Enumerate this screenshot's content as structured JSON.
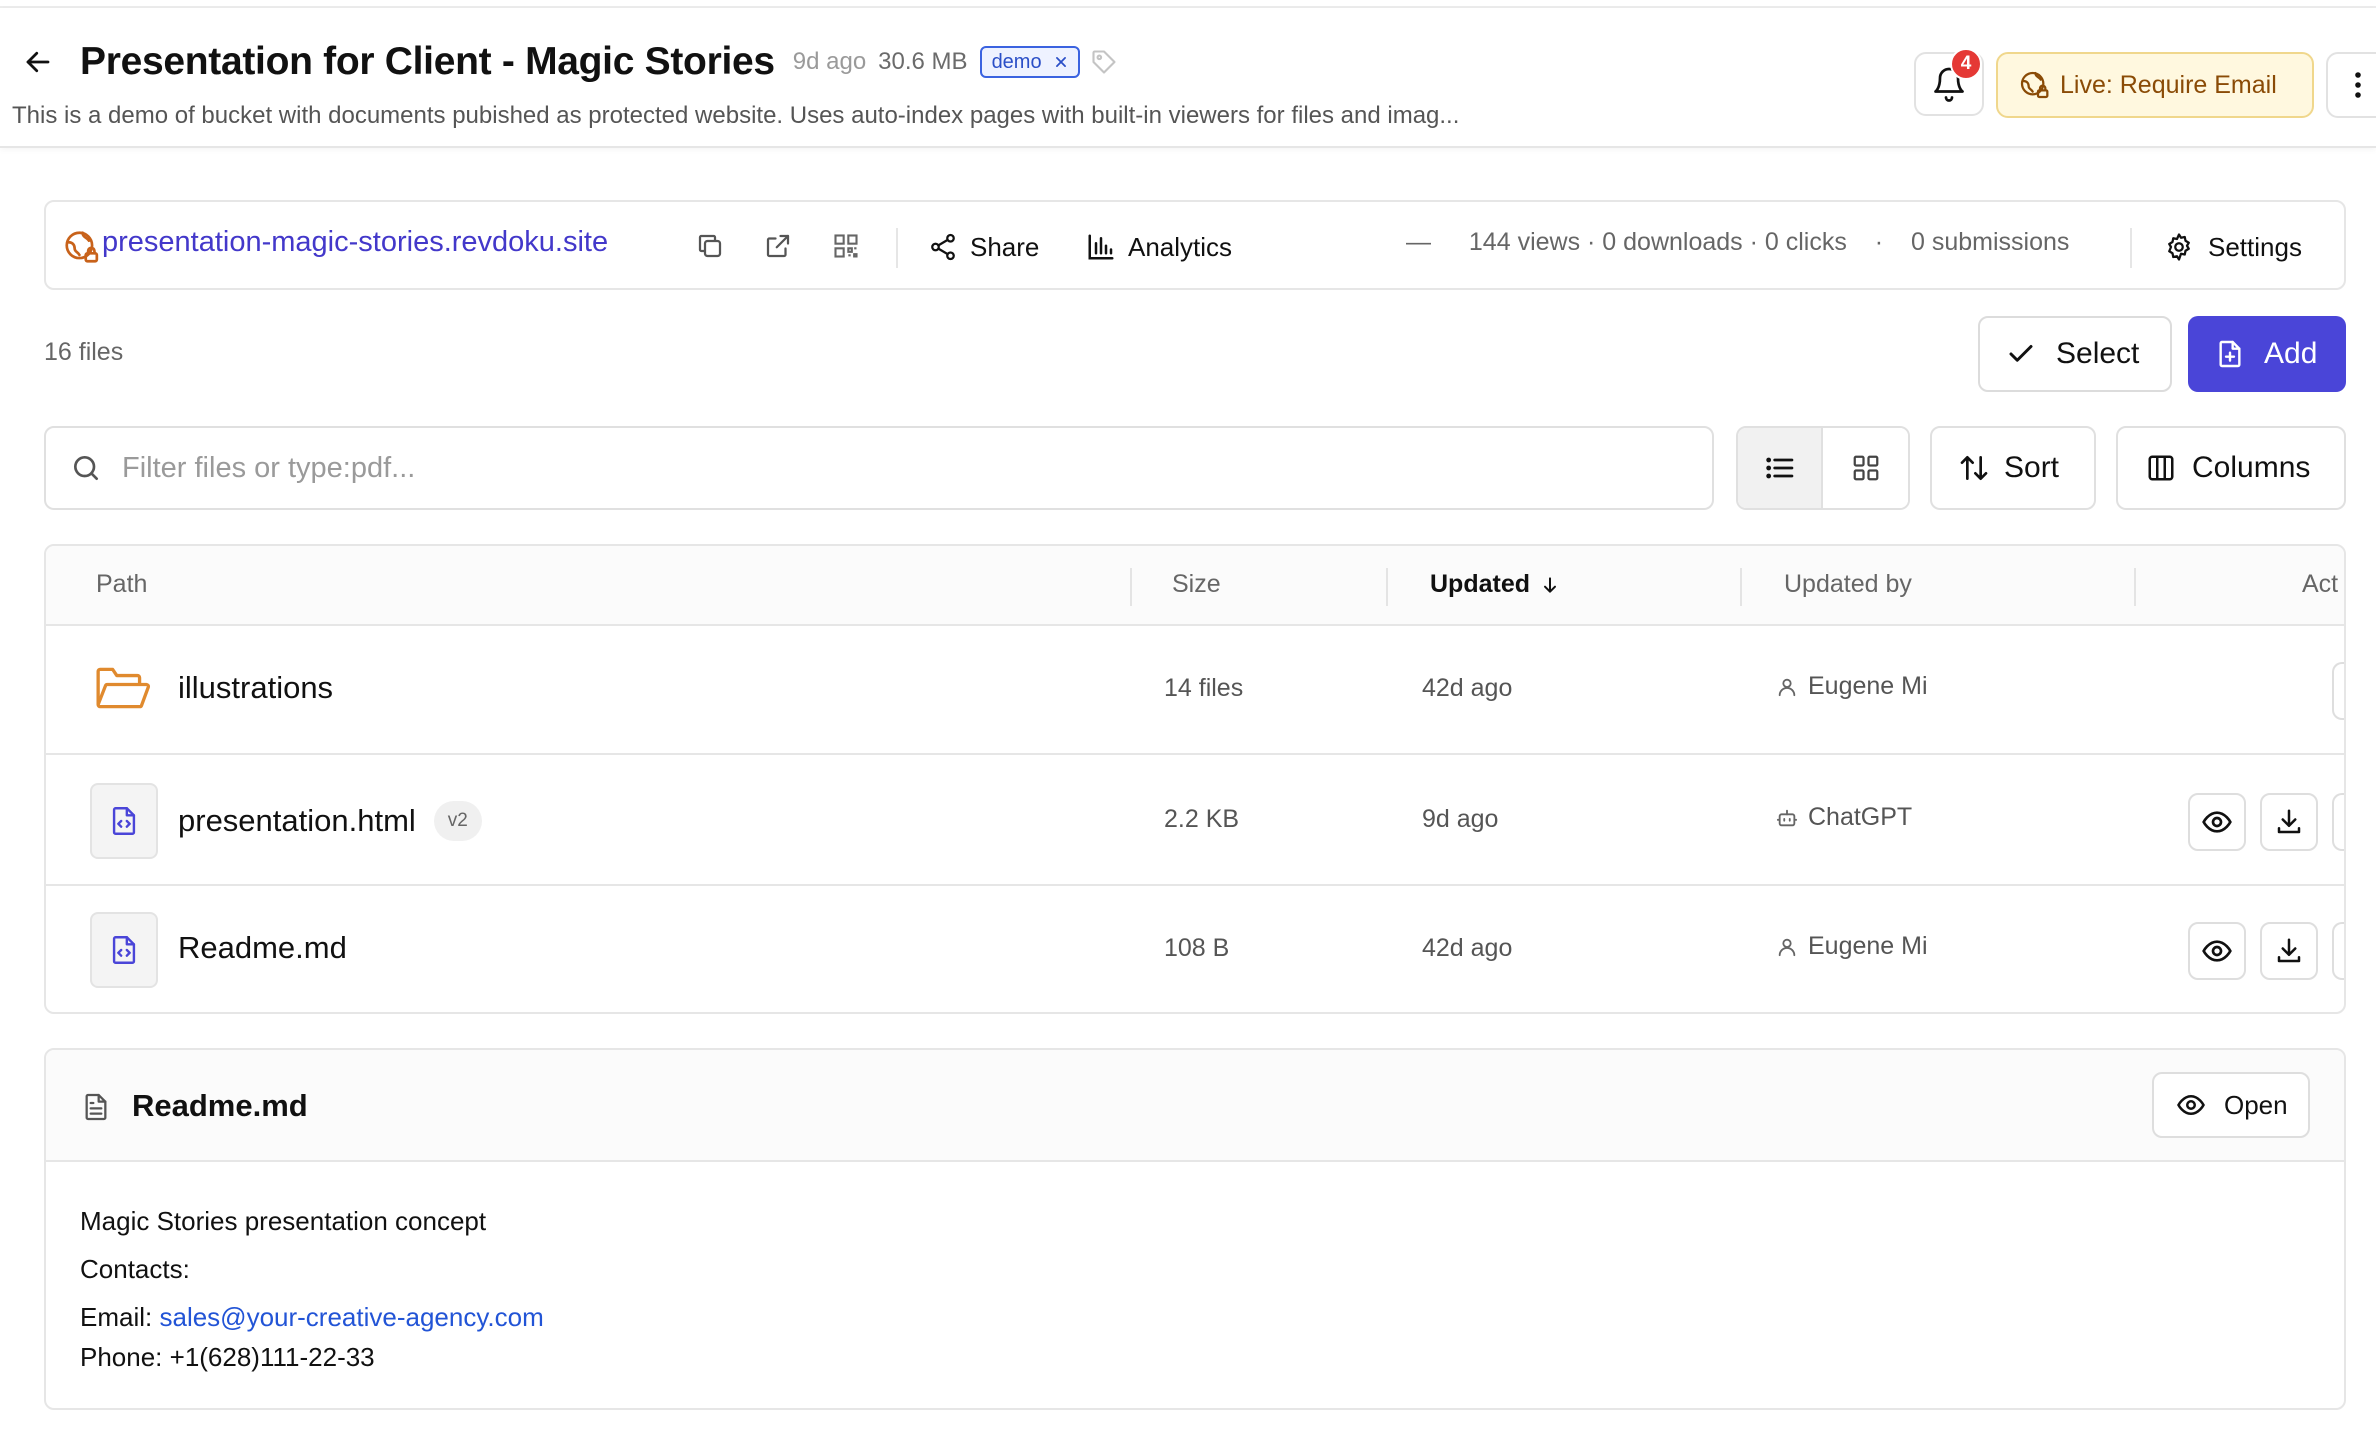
{
  "header": {
    "title": "Presentation for Client - Magic Stories",
    "updated_ago": "9d ago",
    "size": "30.6 MB",
    "tag": "demo",
    "description": "This is a demo of bucket with documents pubished as protected website. Uses auto-index pages with built-in viewers for files and imag...",
    "notification_count": "4",
    "live_label": "Live: Require Email",
    "icons": {
      "back": "arrow-left-icon",
      "tag_add": "tag-icon",
      "bell": "bell-icon",
      "live": "globe-lock-icon",
      "more": "more-vertical-icon"
    }
  },
  "site_bar": {
    "url": "presentation-magic-stories.revdoku.site",
    "share_label": "Share",
    "analytics_label": "Analytics",
    "stats": {
      "dash": "—",
      "views_downloads_clicks": "144 views · 0 downloads · 0 clicks",
      "sep": "·",
      "submissions": "0 submissions"
    },
    "settings_label": "Settings"
  },
  "files": {
    "count_label": "16 files",
    "select_label": "Select",
    "add_label": "Add"
  },
  "toolbar": {
    "search_placeholder": "Filter files or type:pdf...",
    "search_value": "",
    "sort_label": "Sort",
    "columns_label": "Columns",
    "active_view": "list"
  },
  "table": {
    "columns": {
      "path": "Path",
      "size": "Size",
      "updated": "Updated",
      "updated_by": "Updated by",
      "actions": "Act"
    },
    "rows": [
      {
        "name": "illustrations",
        "kind": "folder",
        "version": "",
        "size": "14 files",
        "updated": "42d ago",
        "updated_by": "Eugene Mi",
        "author_type": "user"
      },
      {
        "name": "presentation.html",
        "kind": "file",
        "version": "v2",
        "size": "2.2 KB",
        "updated": "9d ago",
        "updated_by": "ChatGPT",
        "author_type": "bot"
      },
      {
        "name": "Readme.md",
        "kind": "file",
        "version": "",
        "size": "108 B",
        "updated": "42d ago",
        "updated_by": "Eugene Mi",
        "author_type": "user"
      }
    ]
  },
  "readme": {
    "title": "Readme.md",
    "open_label": "Open",
    "lines": {
      "line1": "Magic Stories presentation concept",
      "line2": "Contacts:",
      "email_label": "Email:",
      "email": "sales@your-creative-agency.com",
      "phone": "Phone: +1(628)111-22-33"
    }
  },
  "colors": {
    "accent": "#4a45d8",
    "link": "#4338ca",
    "live_bg": "#fff8df",
    "live_text": "#8a4b06",
    "badge": "#e53935",
    "folder": "#e08a2e"
  }
}
